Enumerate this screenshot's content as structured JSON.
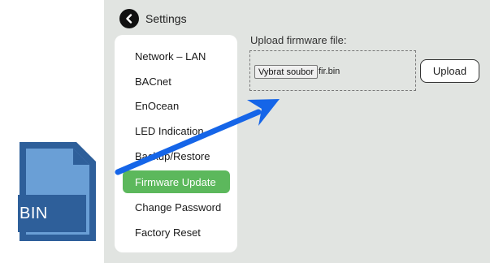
{
  "header": {
    "title": "Settings",
    "back_icon": "chevron-left-icon"
  },
  "nav": {
    "items": [
      {
        "label": "Network – LAN",
        "active": false
      },
      {
        "label": "BACnet",
        "active": false
      },
      {
        "label": "EnOcean",
        "active": false
      },
      {
        "label": "LED Indication",
        "active": false
      },
      {
        "label": "Backup/Restore",
        "active": false
      },
      {
        "label": "Firmware Update",
        "active": true
      },
      {
        "label": "Change Password",
        "active": false
      },
      {
        "label": "Factory Reset",
        "active": false
      }
    ]
  },
  "upload": {
    "label": "Upload firmware file:",
    "choose_button": "Vybrat soubor",
    "file_name": "fir.bin",
    "upload_button": "Upload"
  },
  "file_icon": {
    "label": "BIN",
    "icon": "file-icon"
  },
  "colors": {
    "panel_bg": "#e1e4e1",
    "active_item": "#5cb85c",
    "file_icon_light": "#6a9fd6",
    "file_icon_dark": "#2e5f9a",
    "arrow": "#1565e8"
  }
}
